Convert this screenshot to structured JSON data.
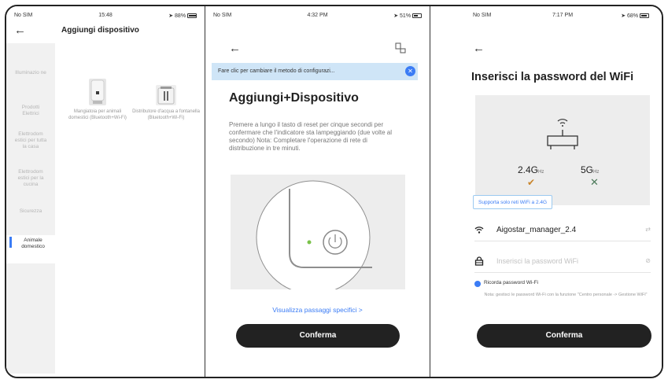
{
  "screen1": {
    "status": {
      "carrier": "No SIM",
      "time": "15:48",
      "battery": "88%"
    },
    "title": "Aggiungi dispositivo",
    "categories": [
      {
        "label": "Illuminazio ne",
        "active": false
      },
      {
        "label": "Prodotti Elettrici",
        "active": false
      },
      {
        "label": "Elettrodom estici per tutta la casa",
        "active": false
      },
      {
        "label": "Elettrodom estici per la cucina",
        "active": false
      },
      {
        "label": "Sicurezza",
        "active": false
      },
      {
        "label": "Animale domestico",
        "active": true
      }
    ],
    "devices": [
      {
        "label": "Mangiatoia per animali domestici (Bluetooth+Wi-Fi)",
        "icon": "pet-feeder-icon"
      },
      {
        "label": "Distributore d'acqua a fontanella (Bluetooth+Wi-Fi)",
        "icon": "water-fountain-icon"
      }
    ]
  },
  "screen2": {
    "status": {
      "carrier": "No SIM",
      "time": "4:32 PM",
      "battery": "51%"
    },
    "banner": "Fare clic per cambiare il metodo di configurazi...",
    "title": "Aggiungi+Dispositivo",
    "description": "Premere a lungo il tasto di reset per cinque secondi per confermare che l'indicatore sta lampeggiando (due volte al secondo) Nota: Completare l'operazione di rete di distribuzione in tre minuti.",
    "link": "Visualizza passaggi specifici >",
    "confirm": "Conferma"
  },
  "screen3": {
    "status": {
      "carrier": "No SIM",
      "time": "7:17 PM",
      "battery": "68%"
    },
    "title": "Inserisci la password del WiFi",
    "band24": {
      "value": "2.4G",
      "unit": "Hz"
    },
    "band5": {
      "value": "5G",
      "unit": "Hz"
    },
    "tip": "Supporta solo reti WiFi a 2.4G",
    "ssid": "Aigostar_manager_2.4",
    "password_placeholder": "Inserisci la password WiFi",
    "remember": "Ricorda password Wi-Fi",
    "note": "Nota: gestisci le password Wi-Fi con la funzione \"Centro personale -> Gestione WiFi\"",
    "confirm": "Conferma"
  },
  "colors": {
    "accent": "#3b7cf5",
    "button": "#222222",
    "banner": "#cfe5f7",
    "check_ok": "#c9852b",
    "check_no": "#4c7a5a"
  }
}
